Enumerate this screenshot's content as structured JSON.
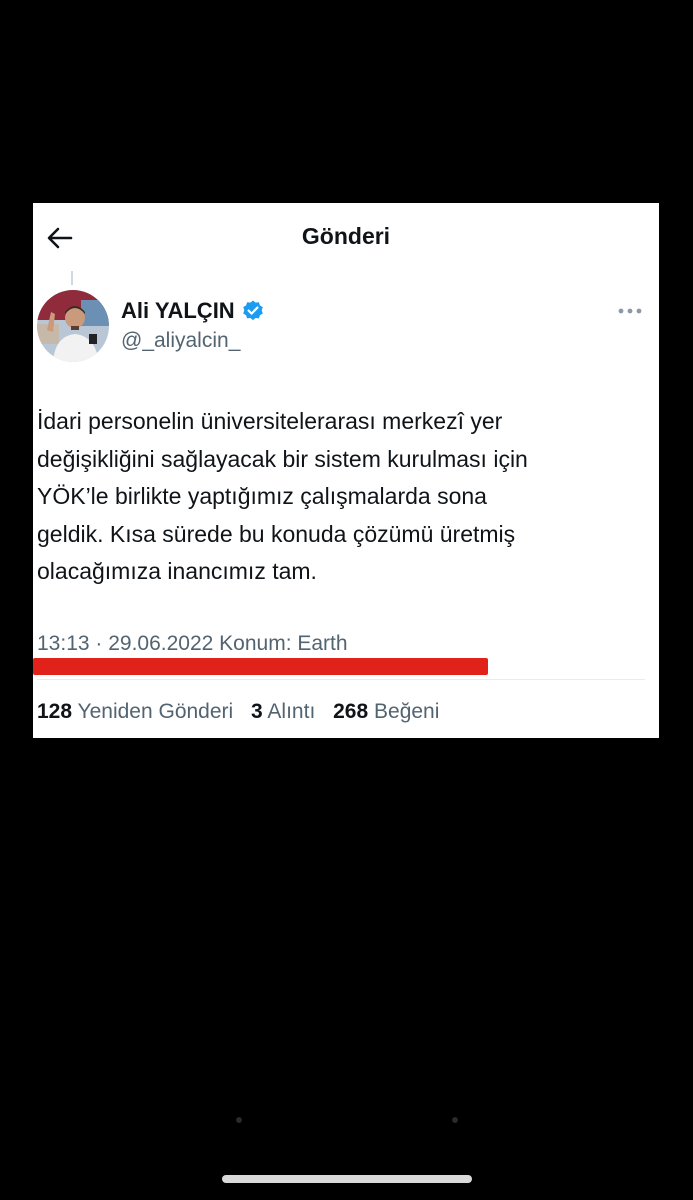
{
  "header": {
    "title": "Gönderi",
    "back_icon": "arrow-left-icon"
  },
  "author": {
    "name": "Ali YALÇIN",
    "handle": "@_aliyalcin_",
    "verified": true,
    "verified_color": "#1d9bf0"
  },
  "tweet": {
    "text": "İdari personelin üniversitelerarası merkezî yer\ndeğişikliğini sağlayacak bir sistem kurulması için\nYÖK’le birlikte yaptığımız çalışmalarda sona\ngeldik. Kısa sürede bu konuda çözümü üretmiş\nolacağımıza inancımız tam.",
    "meta": "13:13 · 29.06.2022 Konum: Earth"
  },
  "stats": {
    "retweets_count": "128",
    "retweets_label": "Yeniden Gönderi",
    "quotes_count": "3",
    "quotes_label": "Alıntı",
    "likes_count": "268",
    "likes_label": "Beğeni"
  },
  "colors": {
    "highlight_underline": "#e0221b",
    "text_primary": "#0f1419",
    "text_secondary": "#536471"
  }
}
